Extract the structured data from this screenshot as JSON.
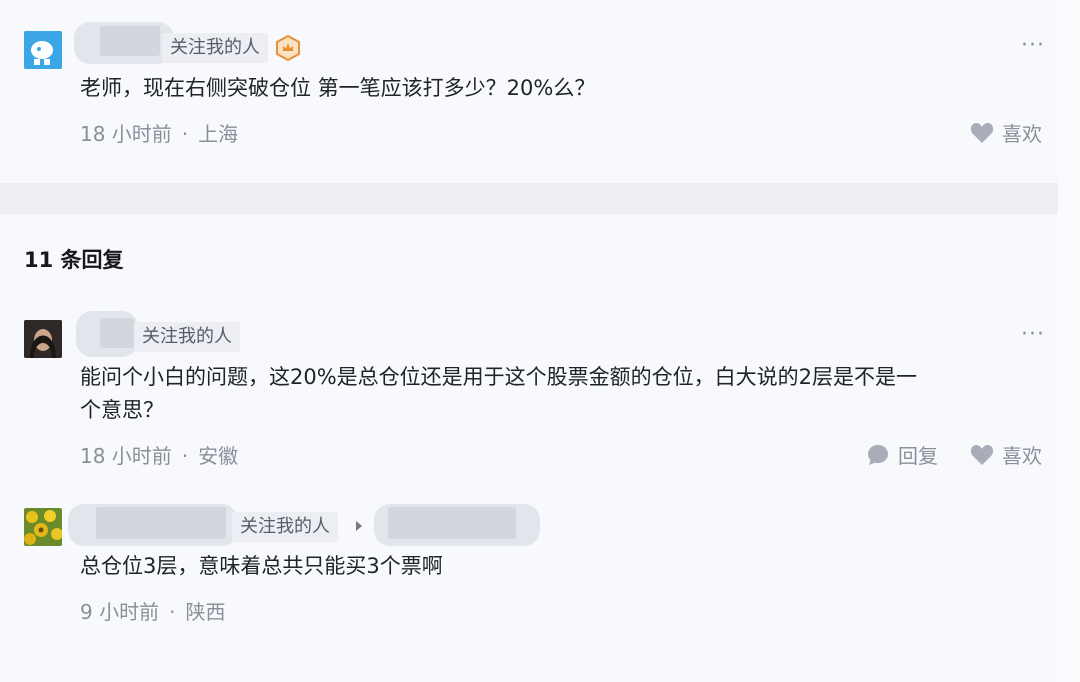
{
  "comment": {
    "follow_tag": "关注我的人",
    "text": "老师，现在右侧突破仓位 第一笔应该打多少？20%么？",
    "time": "18 小时前",
    "location": "上海",
    "like_label": "喜欢",
    "more_label": "···"
  },
  "replies_header": "11 条回复",
  "replies": [
    {
      "follow_tag": "关注我的人",
      "text_line1": "能问个小白的问题，这20%是总仓位还是用于这个股票金额的仓位，白大说的2层是不是一",
      "text_line2": "个意思？",
      "time": "18 小时前",
      "location": "安徽",
      "reply_label": "回复",
      "like_label": "喜欢",
      "more_label": "···"
    },
    {
      "follow_tag": "关注我的人",
      "text": "总仓位3层，意味着总共只能买3个票啊",
      "time": "9 小时前",
      "location": "陕西"
    }
  ],
  "colors": {
    "accent": "#e8913a",
    "text": "#20242a",
    "muted": "#8b8f99",
    "background": "#f8f9fd"
  }
}
